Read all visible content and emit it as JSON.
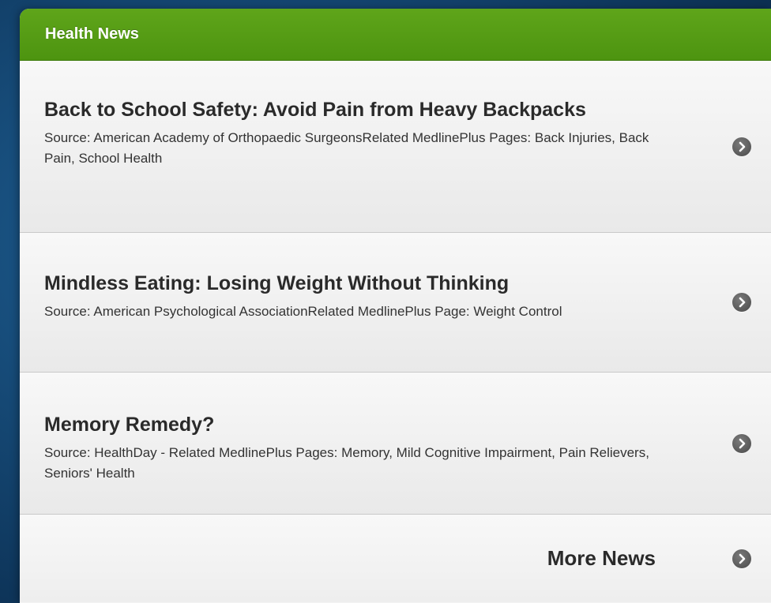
{
  "panel": {
    "title": "Health News"
  },
  "news": [
    {
      "title": "Back to School Safety: Avoid Pain from Heavy Backpacks",
      "description": "Source: American Academy of Orthopaedic SurgeonsRelated MedlinePlus Pages: Back Injuries, Back Pain, School Health"
    },
    {
      "title": "Mindless Eating: Losing Weight Without Thinking",
      "description": "Source: American Psychological AssociationRelated MedlinePlus Page: Weight Control"
    },
    {
      "title": "Memory Remedy?",
      "description": "Source: HealthDay - Related MedlinePlus Pages: Memory, Mild Cognitive Impairment, Pain Relievers, Seniors' Health"
    }
  ],
  "more": {
    "label": "More News"
  },
  "icons": {
    "chevron": "chevron-right-circle-icon"
  },
  "colors": {
    "header_green": "#5fa51a",
    "background_blue": "#174d7b",
    "chevron_gray": "#555555"
  }
}
